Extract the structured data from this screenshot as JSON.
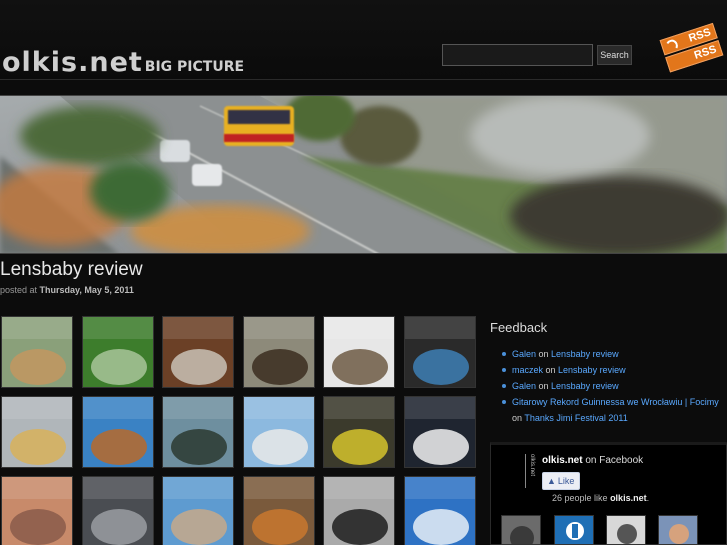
{
  "header": {
    "logo_main": "olkis.net",
    "logo_sub": "BIG PICTURE",
    "search": {
      "value": "",
      "button_label": "Search"
    },
    "rss": {
      "line1": "RSS",
      "line2": "RSS"
    }
  },
  "post": {
    "title": "Lensbaby review",
    "meta_prefix": "posted at",
    "meta_date": "Thursday, May 5, 2011"
  },
  "gallery": {
    "thumbnails": [
      {
        "subject": "tilt-shift street"
      },
      {
        "subject": "grass and tree"
      },
      {
        "subject": "guitar"
      },
      {
        "subject": "horse riders"
      },
      {
        "subject": "coffee desk"
      },
      {
        "subject": "woman with scarf"
      },
      {
        "subject": "people at event"
      },
      {
        "subject": "harvester"
      },
      {
        "subject": "cyclists"
      },
      {
        "subject": "seagulls"
      },
      {
        "subject": "flowers"
      },
      {
        "subject": "wedding couple"
      },
      {
        "subject": "banknotes"
      },
      {
        "subject": "office desk"
      },
      {
        "subject": "coast city"
      },
      {
        "subject": "red squirrel"
      },
      {
        "subject": "portrait black and white"
      },
      {
        "subject": "wind turbine"
      }
    ]
  },
  "sidebar": {
    "feedback_heading": "Feedback",
    "feedback_items": [
      {
        "author": "Galen",
        "sep": " on ",
        "post": "Lensbaby review"
      },
      {
        "author": "maczek",
        "sep": " on ",
        "post": "Lensbaby review"
      },
      {
        "author": "Galen",
        "sep": " on ",
        "post": "Lensbaby review"
      },
      {
        "author": "Gitarowy Rekord Guinnessa we Wrocławiu | Focimy",
        "sep": " on ",
        "post": "Thanks Jimi Festival 2011"
      }
    ],
    "facebook": {
      "vertical_logo": "olkis.net",
      "page_name": "olkis.net",
      "on_text": "on Facebook",
      "like_label": "Like",
      "count_text": "26 people like",
      "count_page": "olkis.net",
      "count_end": "."
    }
  },
  "colors": {
    "background": "#0c0c0c",
    "link": "#5aa9ff",
    "rss_orange": "#e2761b"
  }
}
